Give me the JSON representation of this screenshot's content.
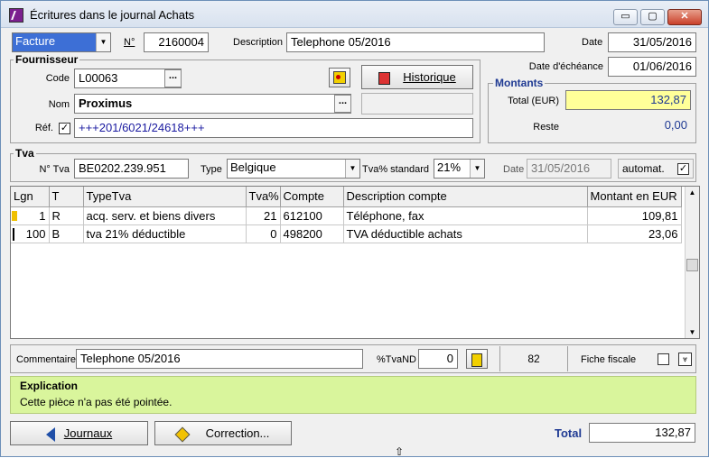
{
  "window": {
    "title": "Écritures dans le journal Achats",
    "min": "▭",
    "max": "▢",
    "close": "✕"
  },
  "header": {
    "doc_type": "Facture",
    "no_label": "N°",
    "no_value": "2160004",
    "description_label": "Description",
    "description_value": "Telephone 05/2016",
    "date_label": "Date",
    "date_value": "31/05/2016",
    "due_label": "Date d'échéance",
    "due_value": "01/06/2016"
  },
  "supplier": {
    "group_label": "Fournisseur",
    "code_label": "Code",
    "code_value": "L00063",
    "name_label": "Nom",
    "name_value": "Proximus",
    "ref_label": "Réf.",
    "ref_value": "+++201/6021/24618+++",
    "history_button": "Historique",
    "lookup_dots": "..."
  },
  "amounts": {
    "group_label": "Montants",
    "total_label": "Total (EUR)",
    "total_value": "132,87",
    "rest_label": "Reste",
    "rest_value": "0,00"
  },
  "tva": {
    "group_label": "Tva",
    "no_label": "N° Tva",
    "no_value": "BE0202.239.951",
    "type_label": "Type",
    "type_value": "Belgique",
    "std_label": "Tva% standard",
    "std_value": "21%",
    "date_label": "Date",
    "date_value": "31/05/2016",
    "auto_label": "automat."
  },
  "grid": {
    "columns": [
      "Lgn",
      "T",
      "TypeTva",
      "Tva%",
      "Compte",
      "Description compte",
      "Montant en EUR"
    ],
    "rows": [
      [
        "1",
        "R",
        "acq. serv. et biens divers",
        "21",
        "612100",
        "Téléphone, fax",
        "109,81"
      ],
      [
        "100",
        "B",
        "tva 21% déductible",
        "0",
        "498200",
        "TVA déductible achats",
        "23,06"
      ]
    ]
  },
  "footer": {
    "comment_label": "Commentaire",
    "comment_value": "Telephone 05/2016",
    "tvand_label": "%TvaND",
    "tvand_value": "0",
    "count_value": "82",
    "fiche_label": "Fiche fiscale",
    "expl_title": "Explication",
    "expl_text": "Cette pièce n'a pas été pointée.",
    "journaux_button": "Journaux",
    "correction_button": "Correction...",
    "total_label": "Total",
    "total_value": "132,87"
  },
  "colors": {
    "amount_highlight": "#ffff99",
    "explanation_bg": "#d9f59c",
    "total_label": "#1f3a93"
  }
}
